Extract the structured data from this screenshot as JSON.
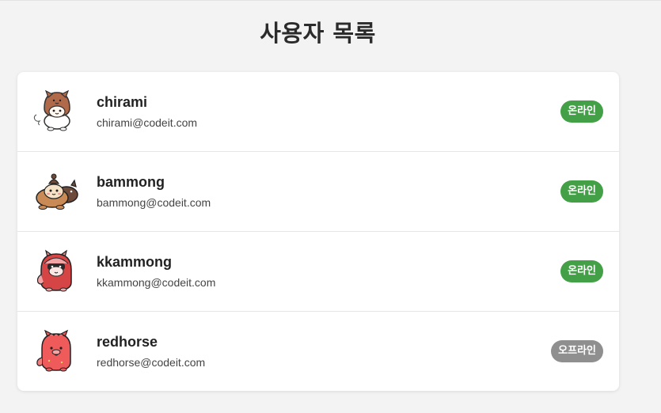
{
  "page": {
    "title": "사용자 목록"
  },
  "colors": {
    "online": "#43a047",
    "offline": "#8f8f8f"
  },
  "users": [
    {
      "name": "chirami",
      "email": "chirami@codeit.com",
      "status": "온라인",
      "status_type": "online",
      "avatar_icon": "chirami-character-icon"
    },
    {
      "name": "bammong",
      "email": "bammong@codeit.com",
      "status": "온라인",
      "status_type": "online",
      "avatar_icon": "bammong-character-icon"
    },
    {
      "name": "kkammong",
      "email": "kkammong@codeit.com",
      "status": "온라인",
      "status_type": "online",
      "avatar_icon": "kkammong-character-icon"
    },
    {
      "name": "redhorse",
      "email": "redhorse@codeit.com",
      "status": "오프라인",
      "status_type": "offline",
      "avatar_icon": "redhorse-character-icon"
    }
  ]
}
